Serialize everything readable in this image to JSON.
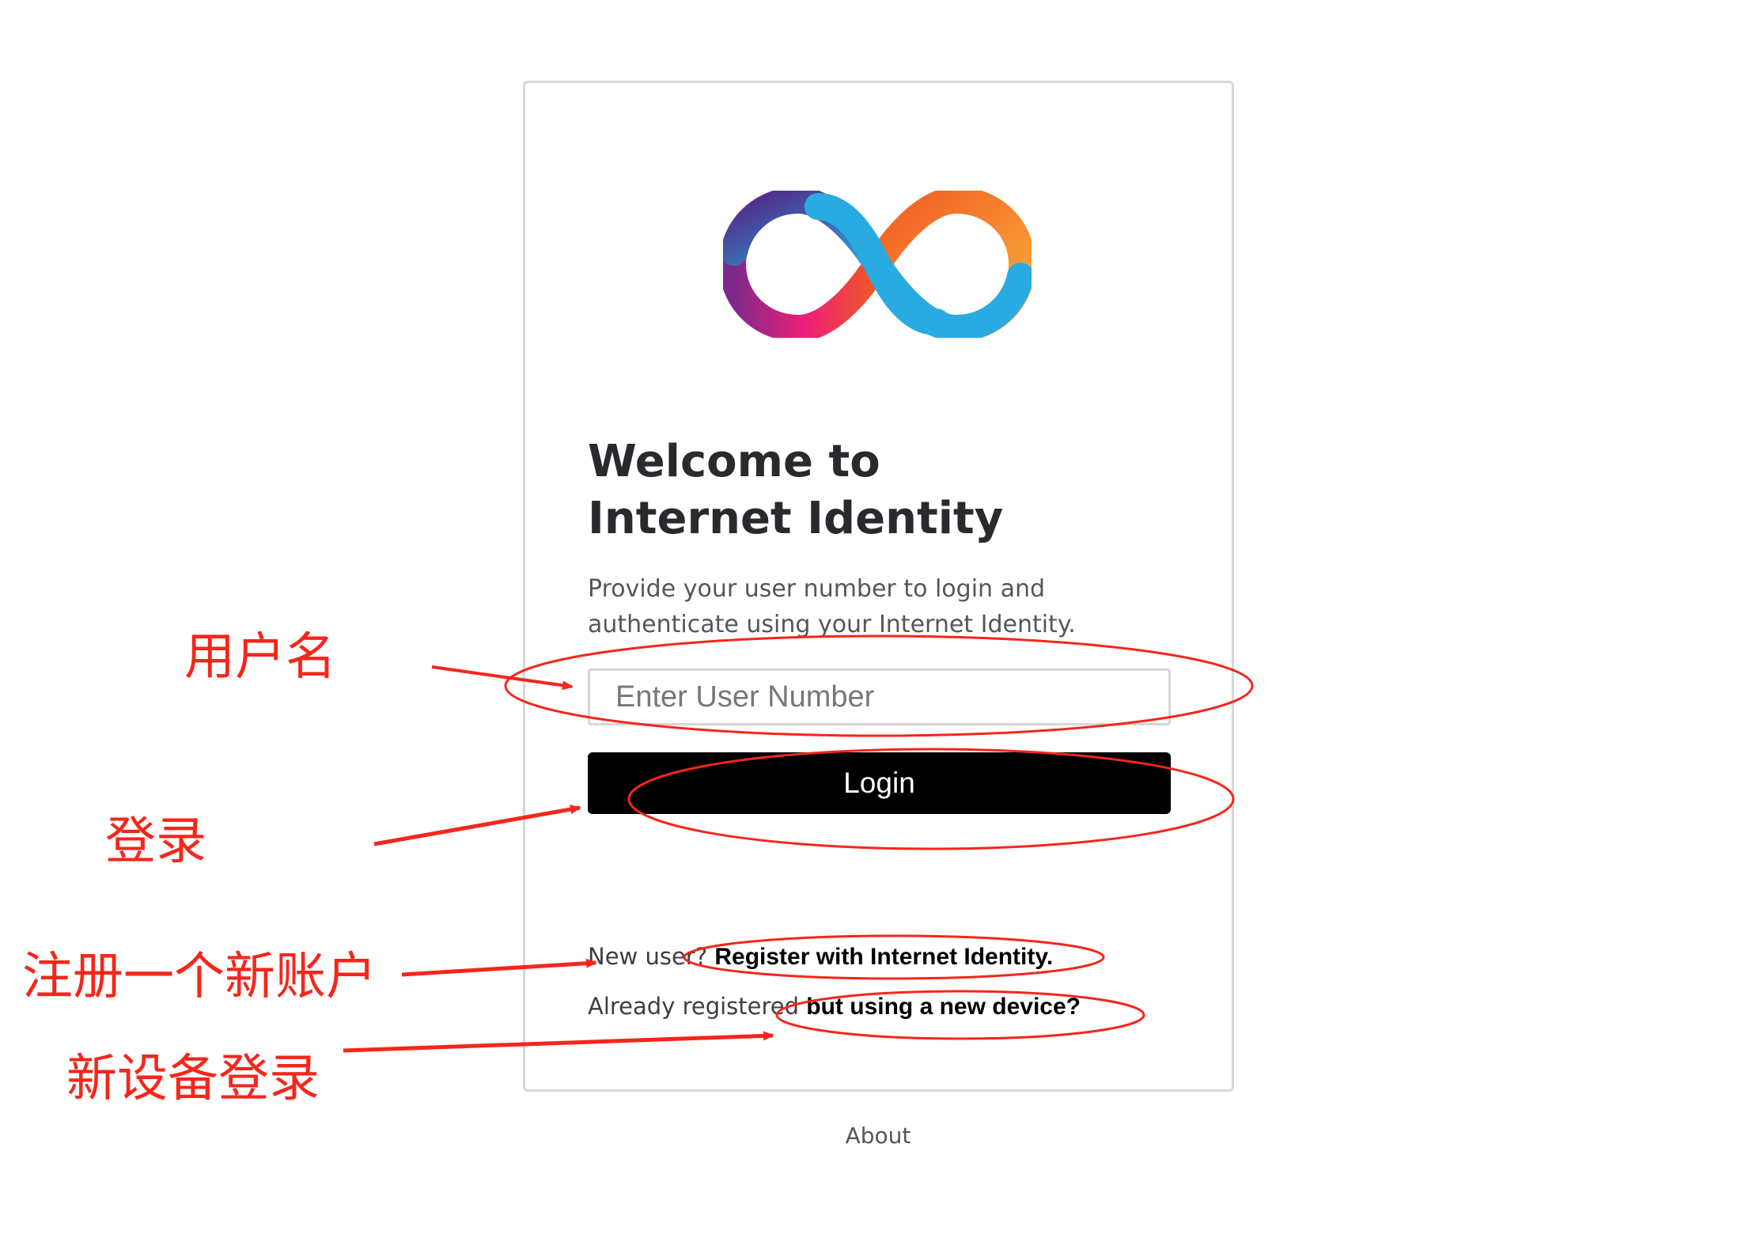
{
  "logo": {
    "name": "internet-identity-infinity-logo"
  },
  "title": {
    "line1": "Welcome to",
    "line2": "Internet Identity"
  },
  "description": {
    "line1": "Provide your user number to login and",
    "line2": "authenticate using your Internet Identity."
  },
  "user_input": {
    "placeholder": "Enter User Number"
  },
  "login_button": {
    "label": "Login"
  },
  "register": {
    "prefix": "New user?",
    "link": "Register with Internet Identity."
  },
  "new_device": {
    "prefix": "Already registered",
    "link": "but using a new device?"
  },
  "footer": {
    "about": "About"
  },
  "annotations": {
    "color": "#f5261b",
    "username": "用户名",
    "login": "登录",
    "register": "注册一个新账户",
    "new_device_login": "新设备登录"
  },
  "colors": {
    "button_bg": "#000000",
    "title": "#292a2e",
    "border": "#d8d8d8"
  }
}
